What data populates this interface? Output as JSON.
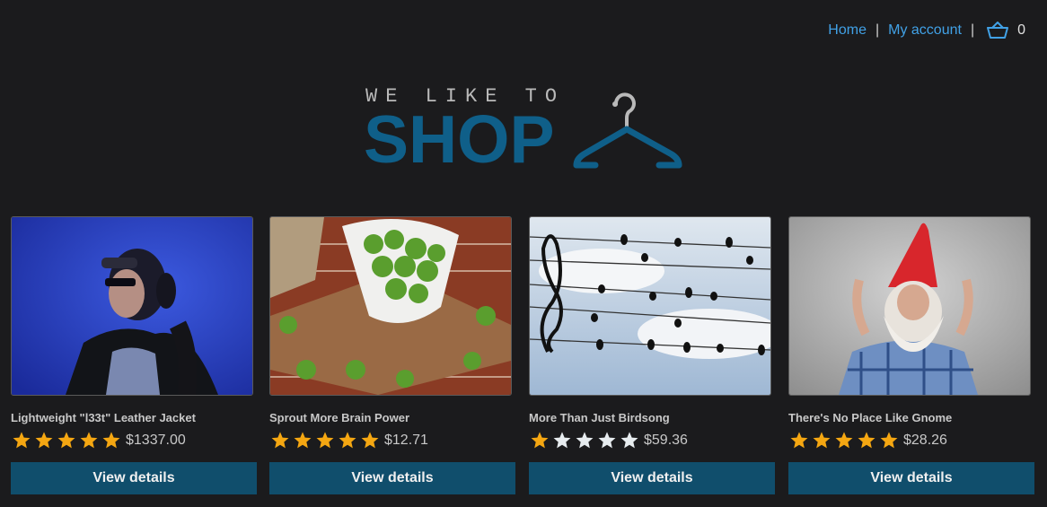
{
  "nav": {
    "home": "Home",
    "separator": "|",
    "account": "My account",
    "cart_icon": "basket-icon",
    "cart_count": "0",
    "link_color": "#41a1e6"
  },
  "logo": {
    "top_text": "WE LIKE TO",
    "main_text": "SHOP",
    "icon": "hanger-icon",
    "brand_color": "#0f5f89"
  },
  "products": [
    {
      "title": "Lightweight \"l33t\" Leather Jacket",
      "rating": 5,
      "price": "$1337.00",
      "button": "View details",
      "image": "woman-with-headphones-photo"
    },
    {
      "title": "Sprout More Brain Power",
      "rating": 5,
      "price": "$12.71",
      "button": "View details",
      "image": "brussels-sprouts-photo"
    },
    {
      "title": "More Than Just Birdsong",
      "rating": 1,
      "price": "$59.36",
      "button": "View details",
      "image": "birds-on-wires-music-photo"
    },
    {
      "title": "There's No Place Like Gnome",
      "rating": 5,
      "price": "$28.26",
      "button": "View details",
      "image": "man-gnome-costume-photo"
    }
  ],
  "colors": {
    "star_filled": "#f5a712",
    "star_empty": "#e7ecef",
    "button": "#104e6c"
  }
}
